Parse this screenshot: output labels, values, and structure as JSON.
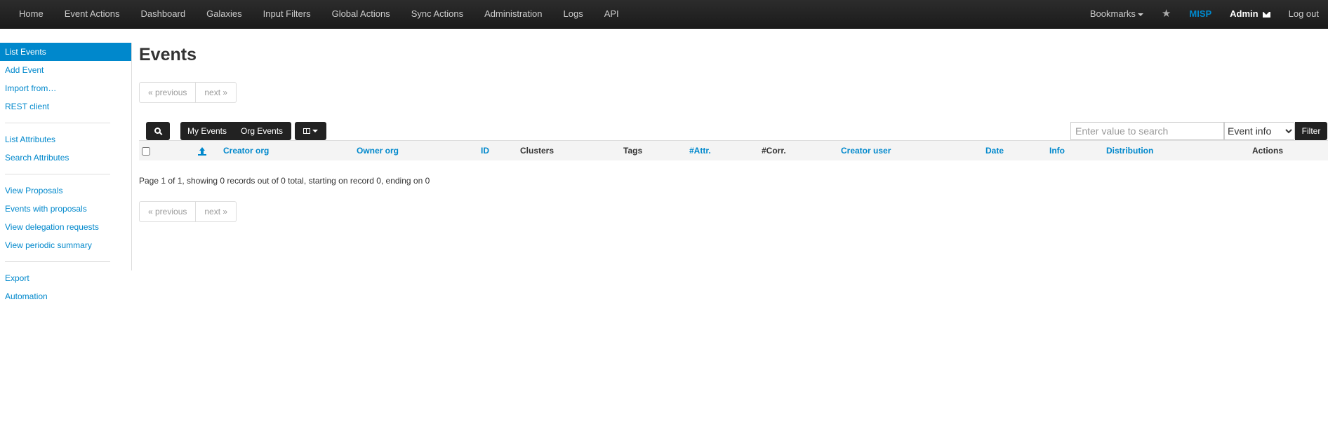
{
  "navbar": {
    "left_items": [
      "Home",
      "Event Actions",
      "Dashboard",
      "Galaxies",
      "Input Filters",
      "Global Actions",
      "Sync Actions",
      "Administration",
      "Logs",
      "API"
    ],
    "bookmarks": "Bookmarks",
    "misp": "MISP",
    "admin": "Admin",
    "logout": "Log out"
  },
  "sidebar": {
    "groups": [
      [
        "List Events",
        "Add Event",
        "Import from…",
        "REST client"
      ],
      [
        "List Attributes",
        "Search Attributes"
      ],
      [
        "View Proposals",
        "Events with proposals",
        "View delegation requests",
        "View periodic summary"
      ],
      [
        "Export",
        "Automation"
      ]
    ],
    "active": "List Events"
  },
  "main": {
    "title": "Events",
    "pager": {
      "previous": "« previous",
      "next": "next »"
    },
    "filters": {
      "my_events": "My Events",
      "org_events": "Org Events"
    },
    "search": {
      "placeholder": "Enter value to search",
      "field": "Event info",
      "filter_button": "Filter"
    },
    "table_headers": {
      "creator_org": "Creator org",
      "owner_org": "Owner org",
      "id": "ID",
      "clusters": "Clusters",
      "tags": "Tags",
      "attr": "#Attr.",
      "corr": "#Corr.",
      "creator_user": "Creator user",
      "date": "Date",
      "info": "Info",
      "distribution": "Distribution",
      "actions": "Actions"
    },
    "page_info": "Page 1 of 1, showing 0 records out of 0 total, starting on record 0, ending on 0"
  },
  "colors": {
    "link": "#0088cc",
    "navbar": "#1b1b1b",
    "active": "#0088cc"
  }
}
